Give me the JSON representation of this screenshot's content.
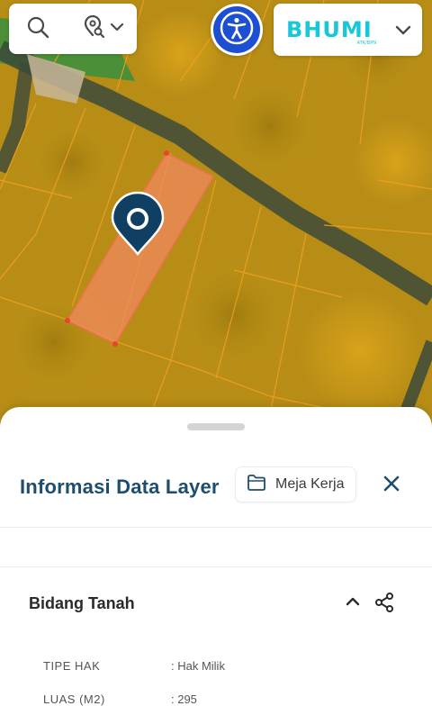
{
  "toolbar": {
    "search_icon": "search-icon",
    "locate_icon": "map-pin-search-icon",
    "locate_dropdown_icon": "chevron-down-icon",
    "accessibility_icon": "accessibility-person-icon",
    "accent_color": "#1c4fd1"
  },
  "brand": {
    "logo_text": "BHUMI",
    "logo_subtext": "ATR/BPN",
    "logo_color": "#18c7d8",
    "dropdown_icon": "chevron-down-icon"
  },
  "map": {
    "marker_icon": "location-pin-icon",
    "selected_parcel_color": "#f08a5d",
    "parcel_overlay_color": "#e8a800"
  },
  "panel": {
    "title": "Informasi Data Layer",
    "workspace_button": "Meja Kerja",
    "workspace_icon": "folder-icon",
    "close_icon": "close-icon",
    "title_color": "#1d4e6e"
  },
  "section": {
    "title": "Bidang Tanah",
    "collapse_icon": "chevron-up-icon",
    "share_icon": "share-icon",
    "attributes": [
      {
        "key": "TIPE HAK",
        "value": ": Hak Milik"
      },
      {
        "key": "LUAS (M2)",
        "value": ": 295"
      }
    ]
  }
}
